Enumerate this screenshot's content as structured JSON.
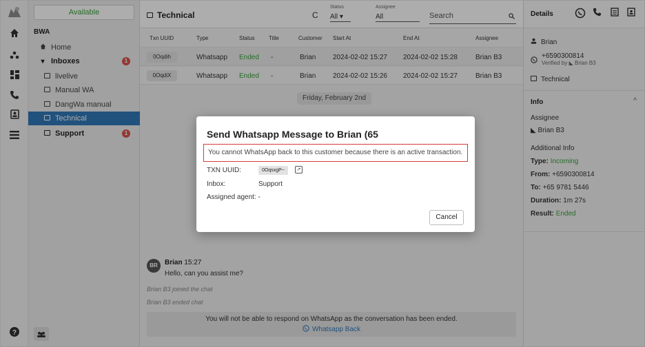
{
  "rail": {
    "icons": [
      "home-icon",
      "groups-icon",
      "dashboard-icon",
      "phone-icon",
      "contacts-icon",
      "list-icon",
      "help-icon"
    ]
  },
  "sidebar": {
    "status": "Available",
    "org": "BWA",
    "home_label": "Home",
    "inboxes_label": "Inboxes",
    "inboxes_badge": "1",
    "items": [
      {
        "label": "livelive"
      },
      {
        "label": "Manual WA"
      },
      {
        "label": "DangWa manual"
      },
      {
        "label": "Technical"
      },
      {
        "label": "Support",
        "badge": "1"
      }
    ]
  },
  "header": {
    "title": "Technical",
    "status_label": "Status",
    "status_value": "All",
    "assignee_label": "Assignee",
    "assignee_value": "All",
    "search_placeholder": "Search"
  },
  "table": {
    "columns": [
      "Txn UUID",
      "Type",
      "Status",
      "Title",
      "Customer",
      "Start At",
      "End At",
      "Assignee"
    ],
    "rows": [
      {
        "uuid": "0Oqdih",
        "type": "Whatsapp",
        "status": "Ended",
        "title": "-",
        "customer": "Brian",
        "start": "2024-02-02 15:27",
        "end": "2024-02-02 15:28",
        "assignee": "Brian B3"
      },
      {
        "uuid": "0OqdiX",
        "type": "Whatsapp",
        "status": "Ended",
        "title": "-",
        "customer": "Brian",
        "start": "2024-02-02 15:26",
        "end": "2024-02-02 15:27",
        "assignee": "Brian B3"
      }
    ]
  },
  "chat": {
    "date_chip": "Friday, February 2nd",
    "avatar_initials": "BR",
    "sender": "Brian",
    "time": "15:27",
    "message": "Hello, can you assist me?",
    "system_joined": "Brian B3 joined the chat",
    "system_ended": "Brian B3 ended chat",
    "footer_text": "You will not be able to respond on WhatsApp as the conversation has been ended.",
    "whatsapp_back_label": "Whatsapp Back"
  },
  "details": {
    "title": "Details",
    "name": "Brian",
    "phone": "+6590300814",
    "verified_by_prefix": "Verified by",
    "verified_by": "Brian B3",
    "inbox": "Technical",
    "info_title": "Info",
    "assignee_label": "Assignee",
    "assignee": "Brian B3",
    "additional_info_label": "Additional Info",
    "type_label": "Type:",
    "type_value": "Incoming",
    "from_label": "From:",
    "from_value": "+6590300814",
    "to_label": "To:",
    "to_value": "+65 9781 5446",
    "duration_label": "Duration:",
    "duration_value": "1m 27s",
    "result_label": "Result:",
    "result_value": "Ended"
  },
  "modal": {
    "title": "Send Whatsapp Message to Brian (65",
    "alert": "You cannot WhatsApp back to this customer because there is an active transaction.",
    "txn_label": "TXN UUID:",
    "txn_value": "0OqsxgP~",
    "inbox_label": "Inbox:",
    "inbox_value": "Support",
    "agent_label": "Assigned agent:",
    "agent_value": "-",
    "cancel_label": "Cancel"
  },
  "colors": {
    "accent": "#3279b8",
    "success": "#3aa03a",
    "danger": "#d33c3c",
    "badge": "#d9534f"
  }
}
